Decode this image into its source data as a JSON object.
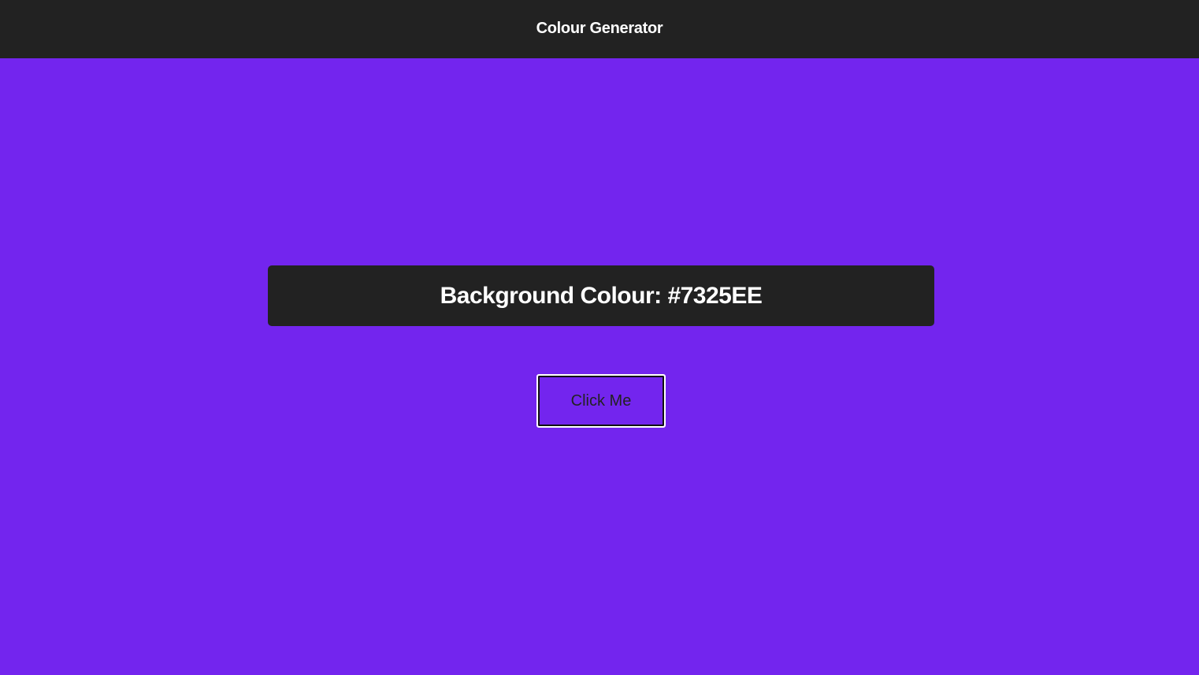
{
  "app": {
    "title": "Colour Generator"
  },
  "display": {
    "label": "Background Colour: #7325EE",
    "current_colour": "#7325EE"
  },
  "button": {
    "label": "Click Me"
  },
  "colors": {
    "header_background": "#222222",
    "panel_background": "#222222",
    "page_background": "#7325EE",
    "text_light": "#FFFFFF"
  }
}
